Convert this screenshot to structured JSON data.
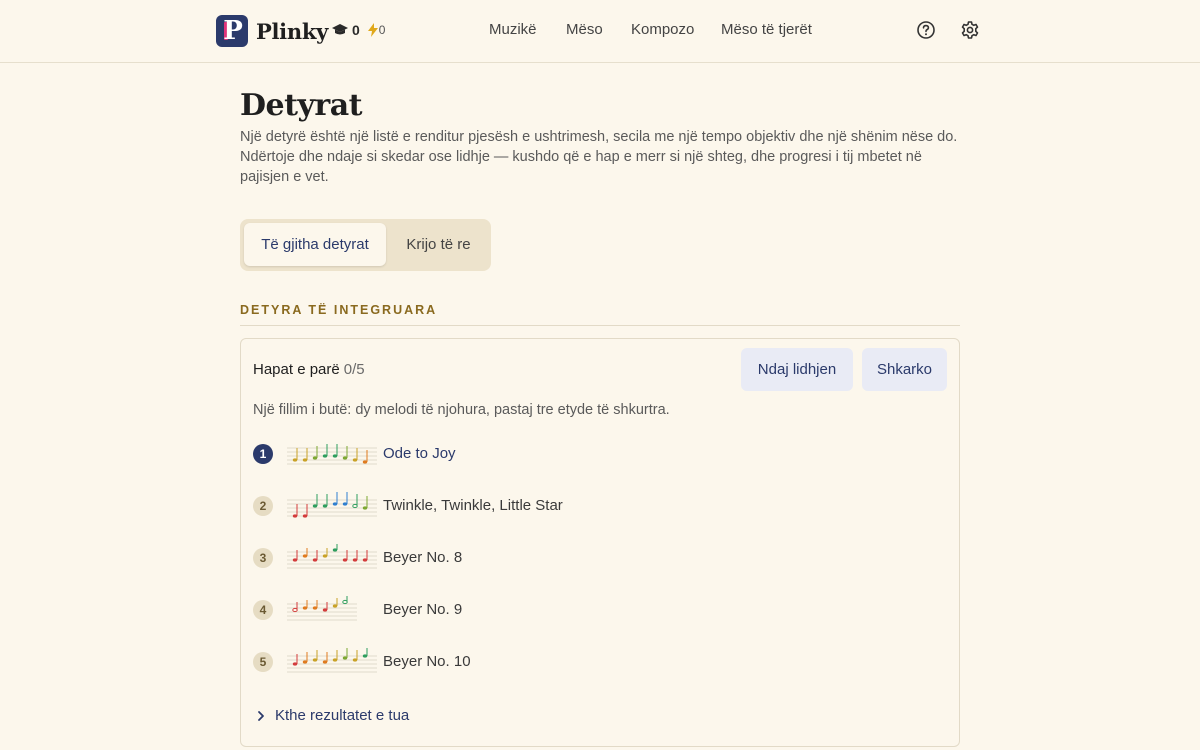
{
  "header": {
    "brand_letter": "P",
    "brand_name": "Plinky",
    "stat_lessons": "0",
    "stat_streak": "0",
    "nav": [
      "Muzikë",
      "Mëso",
      "Kompozo",
      "Mëso të tjerët"
    ]
  },
  "page": {
    "title": "Detyrat",
    "description": "Një detyrë është një listë e renditur pjesësh e ushtrimesh, secila me një tempo objektiv dhe një shënim nëse do. Ndërtoje dhe ndaje si skedar ose lidhje — kushdo që e hap e merr si një shteg, dhe progresi i tij mbetet në pajisjen e vet.",
    "tabs": [
      "Të gjitha detyrat",
      "Krijo të re"
    ],
    "section_heading": "DETYRA TË INTEGRUARA"
  },
  "assignment": {
    "title": "Hapat e parë",
    "progress": "0/5",
    "share_label": "Ndaj lidhjen",
    "download_label": "Shkarko",
    "description": "Një fillim i butë: dy melodi të njohura, pastaj tre etyde të shkurtra.",
    "items": [
      {
        "num": "1",
        "title": "Ode to Joy",
        "current": true
      },
      {
        "num": "2",
        "title": "Twinkle, Twinkle, Little Star",
        "current": false
      },
      {
        "num": "3",
        "title": "Beyer No. 8",
        "current": false
      },
      {
        "num": "4",
        "title": "Beyer No. 9",
        "current": false
      },
      {
        "num": "5",
        "title": "Beyer No. 10",
        "current": false
      }
    ],
    "expand_label": "Kthe rezultatet e tua"
  },
  "colors": {
    "background": "#fcf7ec",
    "accent": "#2b3a6b",
    "section_heading": "#8a6a1f",
    "brand_pink": "#e0337a"
  },
  "icons": [
    "graduation-cap-icon",
    "lightning-icon",
    "help-icon",
    "settings-gear-icon",
    "chevron-right-icon"
  ]
}
